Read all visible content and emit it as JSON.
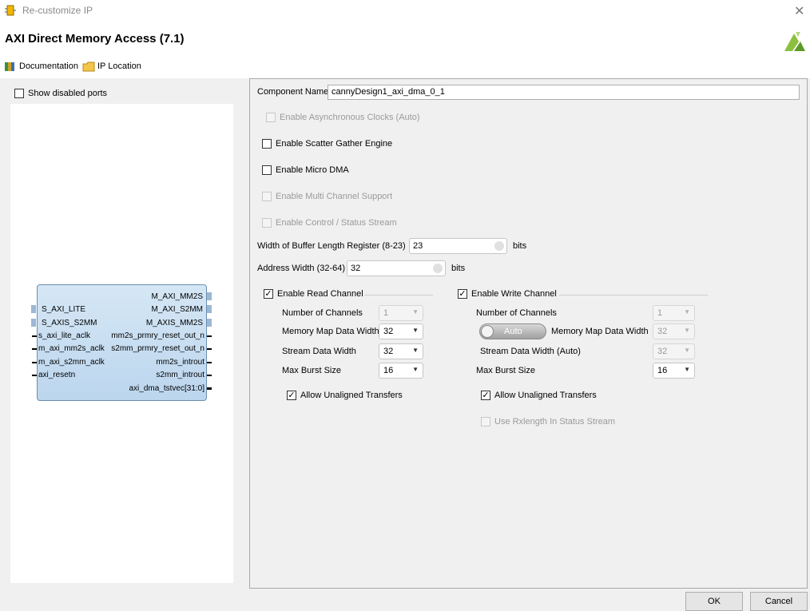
{
  "window": {
    "title": "Re-customize IP",
    "dialog_title": "AXI Direct Memory Access (7.1)"
  },
  "toolbar": {
    "documentation": "Documentation",
    "ip_location": "IP Location"
  },
  "left": {
    "show_disabled_ports": "Show disabled ports"
  },
  "block": {
    "left_ports": [
      "S_AXI_LITE",
      "S_AXIS_S2MM",
      "s_axi_lite_aclk",
      "m_axi_mm2s_aclk",
      "m_axi_s2mm_aclk",
      "axi_resetn"
    ],
    "right_ports": [
      "M_AXI_MM2S",
      "M_AXI_S2MM",
      "M_AXIS_MM2S",
      "mm2s_prmry_reset_out_n",
      "s2mm_prmry_reset_out_n",
      "mm2s_introut",
      "s2mm_introut",
      "axi_dma_tstvec[31:0]"
    ]
  },
  "form": {
    "component_name_label": "Component Name",
    "component_name_value": "cannyDesign1_axi_dma_0_1",
    "async_clocks": "Enable Asynchronous Clocks (Auto)",
    "scatter_gather": "Enable Scatter Gather Engine",
    "micro_dma": "Enable Micro DMA",
    "multi_channel": "Enable Multi Channel Support",
    "control_status": "Enable Control / Status Stream",
    "buffer_len_label": "Width of Buffer Length Register (8-23)",
    "buffer_len_value": "23",
    "address_width_label": "Address Width (32-64)",
    "address_width_value": "32",
    "unit_bits": "bits"
  },
  "read": {
    "header": "Enable Read Channel",
    "num_channels_label": "Number of Channels",
    "num_channels": "1",
    "mm_width_label": "Memory Map Data Width",
    "mm_width": "32",
    "stream_width_label": "Stream Data Width",
    "stream_width": "32",
    "max_burst_label": "Max Burst Size",
    "max_burst": "16",
    "unaligned": "Allow Unaligned Transfers"
  },
  "write": {
    "header": "Enable Write Channel",
    "num_channels_label": "Number of Channels",
    "num_channels": "1",
    "auto_toggle": "Auto",
    "mm_width_label": "Memory Map Data Width",
    "mm_width": "32",
    "stream_width_label": "Stream Data Width (Auto)",
    "stream_width": "32",
    "max_burst_label": "Max Burst Size",
    "max_burst": "16",
    "unaligned": "Allow Unaligned Transfers",
    "rxlength": "Use Rxlength In Status Stream"
  },
  "buttons": {
    "ok": "OK",
    "cancel": "Cancel"
  },
  "colors": {
    "block_fill": "#c9dff2",
    "block_border": "#6b8fb0",
    "logo": "#8cbf3f"
  }
}
